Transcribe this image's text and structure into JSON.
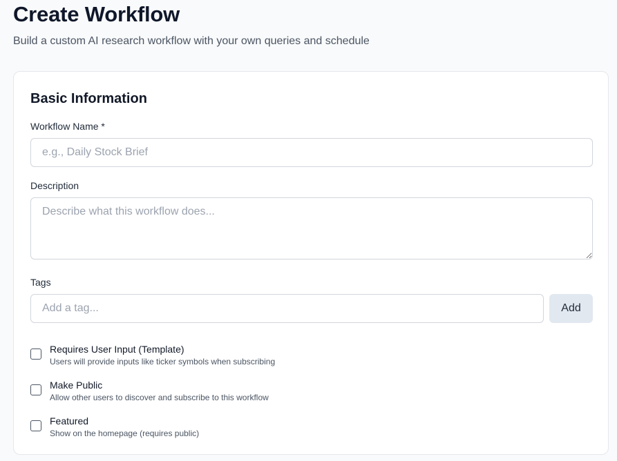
{
  "header": {
    "title": "Create Workflow",
    "subtitle": "Build a custom AI research workflow with your own queries and schedule"
  },
  "basic_info": {
    "section_title": "Basic Information",
    "name_label": "Workflow Name *",
    "name_value": "",
    "name_placeholder": "e.g., Daily Stock Brief",
    "description_label": "Description",
    "description_value": "",
    "description_placeholder": "Describe what this workflow does...",
    "tags_label": "Tags",
    "tags_value": "",
    "tags_placeholder": "Add a tag...",
    "add_button_label": "Add"
  },
  "options": [
    {
      "title": "Requires User Input (Template)",
      "description": "Users will provide inputs like ticker symbols when subscribing",
      "checked": false
    },
    {
      "title": "Make Public",
      "description": "Allow other users to discover and subscribe to this workflow",
      "checked": false
    },
    {
      "title": "Featured",
      "description": "Show on the homepage (requires public)",
      "checked": false
    }
  ]
}
